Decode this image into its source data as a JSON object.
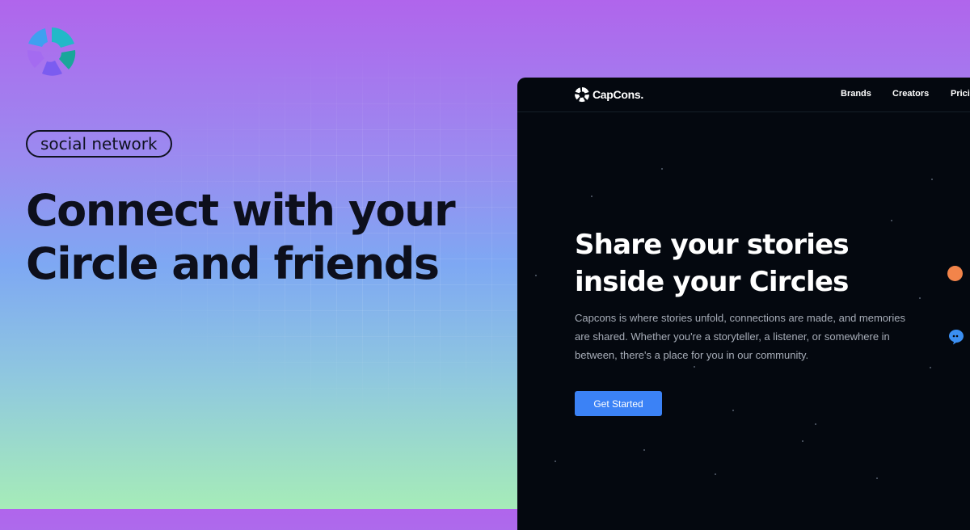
{
  "badge": "social network",
  "headline": {
    "line1": "Connect with your",
    "line2": "Circle and friends"
  },
  "preview": {
    "brand": "CapCons.",
    "nav": [
      "Brands",
      "Creators",
      "Prici"
    ],
    "hero_title": {
      "line1": "Share your stories",
      "line2": "inside your Circles"
    },
    "hero_text": "Capcons is where stories unfold, connections are made, and memories are shared. Whether you're a storyteller, a listener, or somewhere in between, there's a place for you in our community.",
    "cta_label": "Get Started"
  },
  "colors": {
    "accent": "#3b82f6",
    "preview_bg": "#04080f",
    "orange_dot": "#f2844a",
    "headline": "#0d0f1c"
  },
  "icons": [
    "capcons-logo-icon",
    "capcons-brand-icon",
    "chat-bubble-icon"
  ]
}
